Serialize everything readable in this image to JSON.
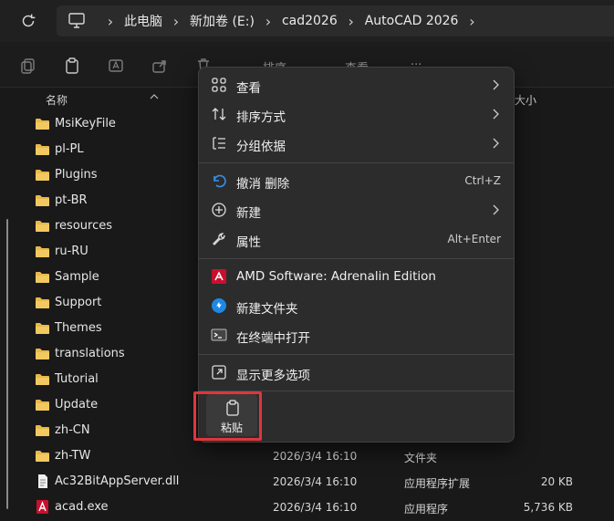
{
  "breadcrumbs": [
    "此电脑",
    "新加卷 (E:)",
    "cad2026",
    "AutoCAD 2026"
  ],
  "toolbar": {
    "sort_label": "排序",
    "view_label": "查看",
    "more_label": "···"
  },
  "columns": {
    "name": "名称",
    "size": "大小"
  },
  "files": [
    {
      "name": "MsiKeyFile",
      "icon": "folder-icon",
      "date": "",
      "type": "",
      "size": ""
    },
    {
      "name": "pl-PL",
      "icon": "folder-icon",
      "date": "",
      "type": "",
      "size": ""
    },
    {
      "name": "Plugins",
      "icon": "folder-icon",
      "date": "",
      "type": "",
      "size": ""
    },
    {
      "name": "pt-BR",
      "icon": "folder-icon",
      "date": "",
      "type": "",
      "size": ""
    },
    {
      "name": "resources",
      "icon": "folder-icon",
      "date": "",
      "type": "",
      "size": ""
    },
    {
      "name": "ru-RU",
      "icon": "folder-icon",
      "date": "",
      "type": "",
      "size": ""
    },
    {
      "name": "Sample",
      "icon": "folder-icon",
      "date": "",
      "type": "",
      "size": ""
    },
    {
      "name": "Support",
      "icon": "folder-icon",
      "date": "",
      "type": "",
      "size": ""
    },
    {
      "name": "Themes",
      "icon": "folder-icon",
      "date": "",
      "type": "",
      "size": ""
    },
    {
      "name": "translations",
      "icon": "folder-icon",
      "date": "",
      "type": "",
      "size": ""
    },
    {
      "name": "Tutorial",
      "icon": "folder-icon",
      "date": "",
      "type": "",
      "size": ""
    },
    {
      "name": "Update",
      "icon": "folder-icon",
      "date": "",
      "type": "",
      "size": ""
    },
    {
      "name": "zh-CN",
      "icon": "folder-icon",
      "date": "",
      "type": "",
      "size": ""
    },
    {
      "name": "zh-TW",
      "icon": "folder-icon",
      "date": "2026/3/4 16:10",
      "type": "文件夹",
      "size": ""
    },
    {
      "name": "Ac32BitAppServer.dll",
      "icon": "dll-file-icon",
      "date": "2026/3/4 16:10",
      "type": "应用程序扩展",
      "size": "20 KB"
    },
    {
      "name": "acad.exe",
      "icon": "autocad-exe-icon",
      "date": "2026/3/4 16:10",
      "type": "应用程序",
      "size": "5,736 KB"
    }
  ],
  "context_menu": {
    "items": [
      {
        "label": "查看",
        "icon": "grid-view-icon",
        "submenu": true,
        "shortcut": ""
      },
      {
        "label": "排序方式",
        "icon": "sort-icon",
        "submenu": true,
        "shortcut": ""
      },
      {
        "label": "分组依据",
        "icon": "group-by-icon",
        "submenu": true,
        "shortcut": ""
      },
      {
        "label": "撤消 删除",
        "icon": "undo-icon",
        "submenu": false,
        "shortcut": "Ctrl+Z"
      },
      {
        "label": "新建",
        "icon": "new-plus-icon",
        "submenu": true,
        "shortcut": ""
      },
      {
        "label": "属性",
        "icon": "wrench-icon",
        "submenu": false,
        "shortcut": "Alt+Enter"
      },
      {
        "label": "AMD Software: Adrenalin Edition",
        "icon": "amd-icon",
        "submenu": false,
        "shortcut": ""
      },
      {
        "label": "新建文件夹",
        "icon": "new-folder-icon",
        "submenu": false,
        "shortcut": ""
      },
      {
        "label": "在终端中打开",
        "icon": "terminal-icon",
        "submenu": false,
        "shortcut": ""
      },
      {
        "label": "显示更多选项",
        "icon": "show-more-icon",
        "submenu": false,
        "shortcut": ""
      }
    ],
    "paste_label": "粘贴"
  },
  "colors": {
    "background": "#191919",
    "menu_bg": "#2c2c2c",
    "folder": "#e8b84a",
    "highlight": "#e0353b",
    "amd_red": "#c8102e",
    "accent_blue": "#1e88e5"
  }
}
